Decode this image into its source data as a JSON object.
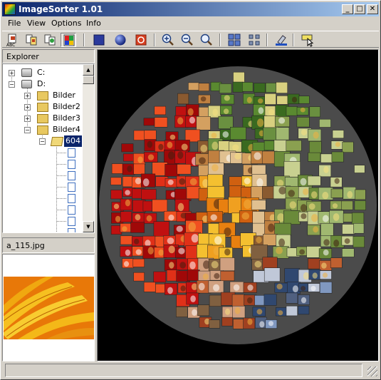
{
  "window": {
    "title": "ImageSorter 1.01"
  },
  "title_buttons": {
    "minimize": "_",
    "maximize": "□",
    "close": "✕"
  },
  "menu": [
    "File",
    "View",
    "Options",
    "Info"
  ],
  "toolbar": [
    "sort-abc-icon",
    "sort-size-icon",
    "sort-date-icon",
    "sort-color-icon",
    "square-view-icon",
    "sphere-view-icon",
    "circle-view-icon",
    "zoom-in-icon",
    "zoom-out-icon",
    "zoom-fit-icon",
    "grid-large-icon",
    "grid-small-icon",
    "color-picker-icon",
    "select-icon"
  ],
  "explorer": {
    "title": "Explorer",
    "tree": [
      {
        "label": "C:",
        "expander": "+",
        "icon": "drive"
      },
      {
        "label": "D:",
        "expander": "−",
        "icon": "drive"
      },
      {
        "label": "Bilder",
        "expander": "+",
        "icon": "folder"
      },
      {
        "label": "Bilder2",
        "expander": "+",
        "icon": "folder"
      },
      {
        "label": "Bilder3",
        "expander": "+",
        "icon": "folder"
      },
      {
        "label": "Bilder4",
        "expander": "−",
        "icon": "folder"
      },
      {
        "label": "604",
        "expander": "−",
        "icon": "folder-open",
        "selected": true
      }
    ]
  },
  "preview": {
    "filename": "a_115.jpg"
  },
  "colors": {
    "titlebar_start": "#0a246a",
    "titlebar_end": "#a6caf0",
    "canvas_bg": "#000000",
    "sphere_bg": "#4b4b4b"
  }
}
